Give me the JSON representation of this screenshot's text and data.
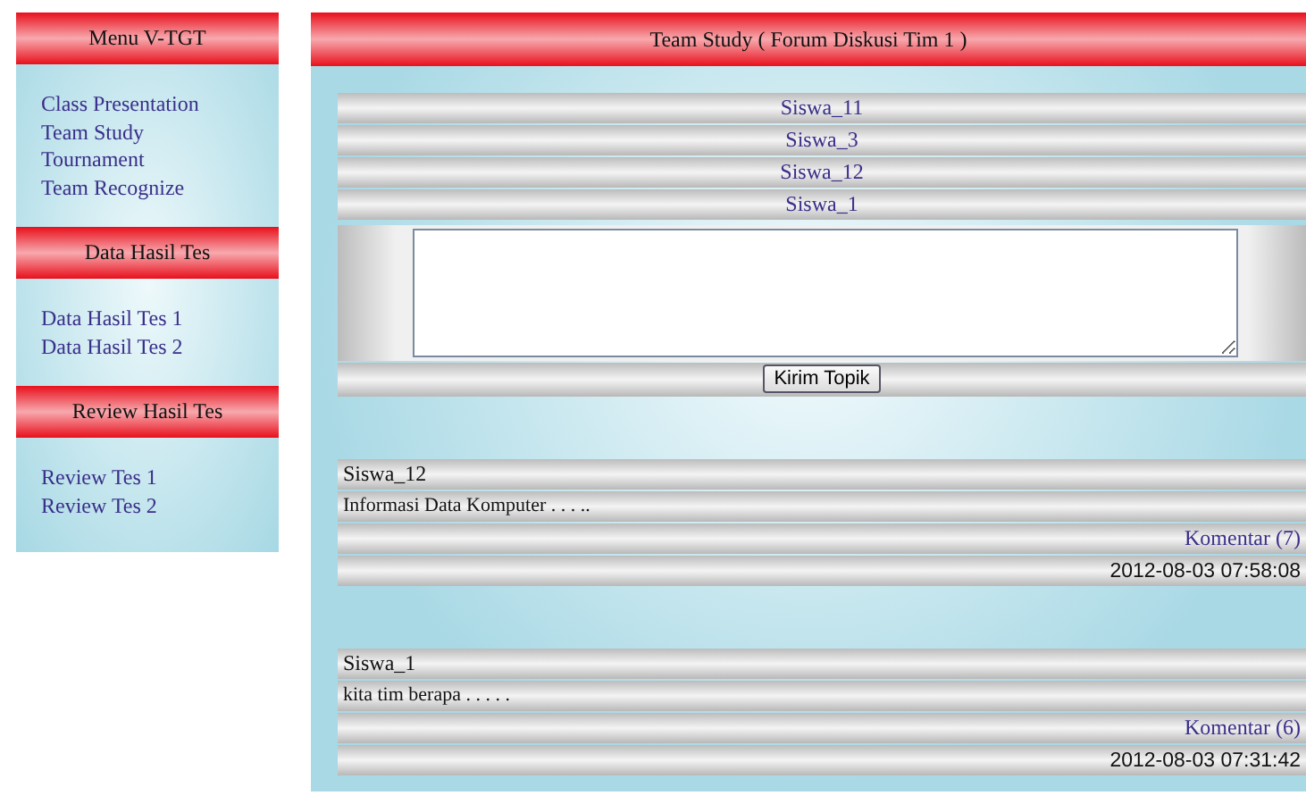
{
  "sidebar": {
    "sections": [
      {
        "title": "Menu V-TGT",
        "items": [
          "Class Presentation",
          "Team Study",
          "Tournament",
          "Team Recognize"
        ]
      },
      {
        "title": "Data Hasil Tes",
        "items": [
          "Data Hasil Tes 1",
          "Data Hasil Tes 2"
        ]
      },
      {
        "title": "Review Hasil Tes",
        "items": [
          "Review Tes 1",
          "Review Tes 2"
        ]
      }
    ]
  },
  "main": {
    "title": "Team Study ( Forum Diskusi Tim 1 )",
    "members": [
      "Siswa_11",
      "Siswa_3",
      "Siswa_12",
      "Siswa_1"
    ],
    "submit_button": "Kirim Topik",
    "posts": [
      {
        "author": "Siswa_12",
        "text": "Informasi Data Komputer . . . ..",
        "comments": "Komentar (7)",
        "time": "2012-08-03 07:58:08"
      },
      {
        "author": "Siswa_1",
        "text": "kita tim berapa . . . . .",
        "comments": "Komentar (6)",
        "time": "2012-08-03 07:31:42"
      }
    ]
  }
}
